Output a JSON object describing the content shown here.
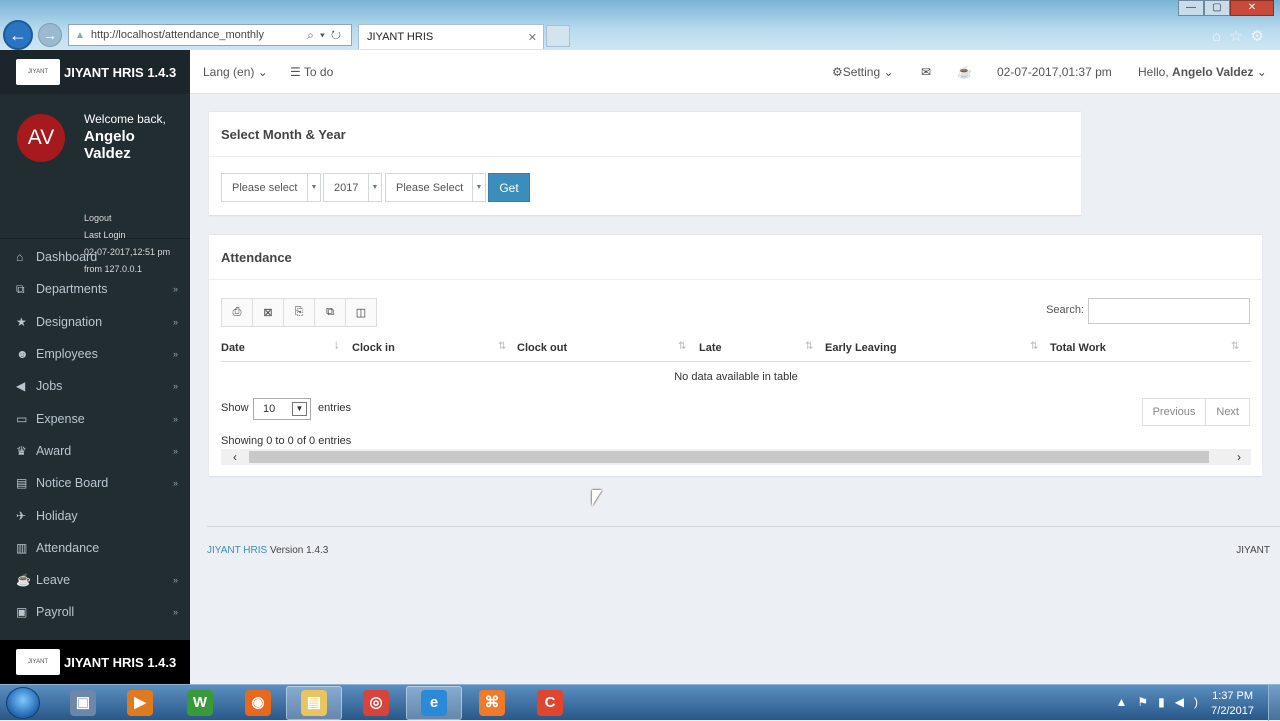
{
  "browser": {
    "url": "http://localhost/attendance_monthly",
    "tab_title": "JIYANT HRIS",
    "tab_close": "✕",
    "back_icon": "←",
    "forward_icon": "→",
    "controls": {
      "minimize": "—",
      "maximize": "▢",
      "close": "✕"
    },
    "right_icons": "⌂☆⚙"
  },
  "brand": {
    "name": "JIYANT HRIS 1.4.3",
    "logo_text": "JIYANT"
  },
  "user": {
    "initials": "AV",
    "welcome": "Welcome back,",
    "name": "Angelo Valdez",
    "logout": "Logout",
    "last_login_label": "Last Login",
    "last_login_time": "02-07-2017,12:51 pm",
    "last_login_from": "from 127.0.0.1"
  },
  "sidebar": {
    "items": [
      {
        "label": "Dashboard",
        "icon": "⌂",
        "expandable": false
      },
      {
        "label": "Departments",
        "icon": "⧉",
        "expandable": true
      },
      {
        "label": "Designation",
        "icon": "★",
        "expandable": true
      },
      {
        "label": "Employees",
        "icon": "☻",
        "expandable": true
      },
      {
        "label": "Jobs",
        "icon": "◀",
        "expandable": true
      },
      {
        "label": "Expense",
        "icon": "▭",
        "expandable": true
      },
      {
        "label": "Award",
        "icon": "♛",
        "expandable": true
      },
      {
        "label": "Notice Board",
        "icon": "▤",
        "expandable": true
      },
      {
        "label": "Holiday",
        "icon": "✈",
        "expandable": false
      },
      {
        "label": "Attendance",
        "icon": "▥",
        "expandable": false
      },
      {
        "label": "Leave",
        "icon": "☕",
        "expandable": true
      },
      {
        "label": "Payroll",
        "icon": "▣",
        "expandable": true
      }
    ],
    "chevron": "»"
  },
  "topbar": {
    "lang": "Lang (en)",
    "todo": "To do",
    "setting": "Setting",
    "datetime": "02-07-2017,01:37 pm",
    "hello": "Hello,",
    "username": "Angelo Valdez",
    "caret": "⌄"
  },
  "month_year": {
    "title": "Select Month & Year",
    "month_select": "Please select",
    "year_select": "2017",
    "employee_select": "Please Select",
    "get_button": "Get"
  },
  "attendance": {
    "title": "Attendance",
    "tool_buttons": [
      "⎙",
      "⊠",
      "⎘",
      "⧉",
      "◫"
    ],
    "search_label": "Search:",
    "columns": [
      "Date",
      "Clock in",
      "Clock out",
      "Late",
      "Early Leaving",
      "Total Work"
    ],
    "empty_message": "No data available in table",
    "show_label": "Show",
    "page_length": "10",
    "entries_label": "entries",
    "previous": "Previous",
    "next": "Next",
    "info": "Showing 0 to 0 of 0 entries"
  },
  "footer": {
    "link": "JIYANT HRIS",
    "version": "Version 1.4.3",
    "right": "JIYANT"
  },
  "taskbar": {
    "apps": [
      {
        "name": "explorer-window",
        "glyph": "▣",
        "color": "#6d87a8"
      },
      {
        "name": "media-player",
        "glyph": "▶",
        "color": "#e07a1f"
      },
      {
        "name": "word",
        "glyph": "W",
        "color": "#3a9a3a"
      },
      {
        "name": "firefox",
        "glyph": "◉",
        "color": "#e8681e"
      },
      {
        "name": "file-explorer",
        "glyph": "▤",
        "color": "#e9c560"
      },
      {
        "name": "chrome",
        "glyph": "◎",
        "color": "#d8433b"
      },
      {
        "name": "internet-explorer",
        "glyph": "e",
        "color": "#2a8ad8"
      },
      {
        "name": "xampp",
        "glyph": "⌘",
        "color": "#f07a2a"
      },
      {
        "name": "codeigniter",
        "glyph": "C",
        "color": "#e0452e"
      }
    ],
    "tray_icons": "▲⚑▮◀)",
    "time": "1:37 PM",
    "date": "7/2/2017"
  }
}
